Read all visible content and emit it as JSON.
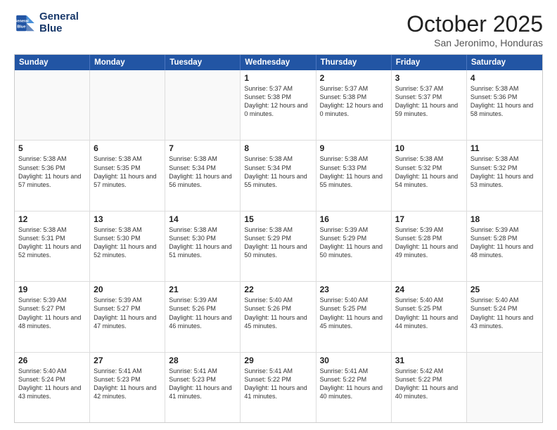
{
  "logo": {
    "line1": "General",
    "line2": "Blue"
  },
  "title": "October 2025",
  "location": "San Jeronimo, Honduras",
  "header_days": [
    "Sunday",
    "Monday",
    "Tuesday",
    "Wednesday",
    "Thursday",
    "Friday",
    "Saturday"
  ],
  "rows": [
    [
      {
        "day": "",
        "text": "",
        "empty": true
      },
      {
        "day": "",
        "text": "",
        "empty": true
      },
      {
        "day": "",
        "text": "",
        "empty": true
      },
      {
        "day": "1",
        "text": "Sunrise: 5:37 AM\nSunset: 5:38 PM\nDaylight: 12 hours\nand 0 minutes.",
        "empty": false
      },
      {
        "day": "2",
        "text": "Sunrise: 5:37 AM\nSunset: 5:38 PM\nDaylight: 12 hours\nand 0 minutes.",
        "empty": false
      },
      {
        "day": "3",
        "text": "Sunrise: 5:37 AM\nSunset: 5:37 PM\nDaylight: 11 hours\nand 59 minutes.",
        "empty": false
      },
      {
        "day": "4",
        "text": "Sunrise: 5:38 AM\nSunset: 5:36 PM\nDaylight: 11 hours\nand 58 minutes.",
        "empty": false
      }
    ],
    [
      {
        "day": "5",
        "text": "Sunrise: 5:38 AM\nSunset: 5:36 PM\nDaylight: 11 hours\nand 57 minutes.",
        "empty": false
      },
      {
        "day": "6",
        "text": "Sunrise: 5:38 AM\nSunset: 5:35 PM\nDaylight: 11 hours\nand 57 minutes.",
        "empty": false
      },
      {
        "day": "7",
        "text": "Sunrise: 5:38 AM\nSunset: 5:34 PM\nDaylight: 11 hours\nand 56 minutes.",
        "empty": false
      },
      {
        "day": "8",
        "text": "Sunrise: 5:38 AM\nSunset: 5:34 PM\nDaylight: 11 hours\nand 55 minutes.",
        "empty": false
      },
      {
        "day": "9",
        "text": "Sunrise: 5:38 AM\nSunset: 5:33 PM\nDaylight: 11 hours\nand 55 minutes.",
        "empty": false
      },
      {
        "day": "10",
        "text": "Sunrise: 5:38 AM\nSunset: 5:32 PM\nDaylight: 11 hours\nand 54 minutes.",
        "empty": false
      },
      {
        "day": "11",
        "text": "Sunrise: 5:38 AM\nSunset: 5:32 PM\nDaylight: 11 hours\nand 53 minutes.",
        "empty": false
      }
    ],
    [
      {
        "day": "12",
        "text": "Sunrise: 5:38 AM\nSunset: 5:31 PM\nDaylight: 11 hours\nand 52 minutes.",
        "empty": false
      },
      {
        "day": "13",
        "text": "Sunrise: 5:38 AM\nSunset: 5:30 PM\nDaylight: 11 hours\nand 52 minutes.",
        "empty": false
      },
      {
        "day": "14",
        "text": "Sunrise: 5:38 AM\nSunset: 5:30 PM\nDaylight: 11 hours\nand 51 minutes.",
        "empty": false
      },
      {
        "day": "15",
        "text": "Sunrise: 5:38 AM\nSunset: 5:29 PM\nDaylight: 11 hours\nand 50 minutes.",
        "empty": false
      },
      {
        "day": "16",
        "text": "Sunrise: 5:39 AM\nSunset: 5:29 PM\nDaylight: 11 hours\nand 50 minutes.",
        "empty": false
      },
      {
        "day": "17",
        "text": "Sunrise: 5:39 AM\nSunset: 5:28 PM\nDaylight: 11 hours\nand 49 minutes.",
        "empty": false
      },
      {
        "day": "18",
        "text": "Sunrise: 5:39 AM\nSunset: 5:28 PM\nDaylight: 11 hours\nand 48 minutes.",
        "empty": false
      }
    ],
    [
      {
        "day": "19",
        "text": "Sunrise: 5:39 AM\nSunset: 5:27 PM\nDaylight: 11 hours\nand 48 minutes.",
        "empty": false
      },
      {
        "day": "20",
        "text": "Sunrise: 5:39 AM\nSunset: 5:27 PM\nDaylight: 11 hours\nand 47 minutes.",
        "empty": false
      },
      {
        "day": "21",
        "text": "Sunrise: 5:39 AM\nSunset: 5:26 PM\nDaylight: 11 hours\nand 46 minutes.",
        "empty": false
      },
      {
        "day": "22",
        "text": "Sunrise: 5:40 AM\nSunset: 5:26 PM\nDaylight: 11 hours\nand 45 minutes.",
        "empty": false
      },
      {
        "day": "23",
        "text": "Sunrise: 5:40 AM\nSunset: 5:25 PM\nDaylight: 11 hours\nand 45 minutes.",
        "empty": false
      },
      {
        "day": "24",
        "text": "Sunrise: 5:40 AM\nSunset: 5:25 PM\nDaylight: 11 hours\nand 44 minutes.",
        "empty": false
      },
      {
        "day": "25",
        "text": "Sunrise: 5:40 AM\nSunset: 5:24 PM\nDaylight: 11 hours\nand 43 minutes.",
        "empty": false
      }
    ],
    [
      {
        "day": "26",
        "text": "Sunrise: 5:40 AM\nSunset: 5:24 PM\nDaylight: 11 hours\nand 43 minutes.",
        "empty": false
      },
      {
        "day": "27",
        "text": "Sunrise: 5:41 AM\nSunset: 5:23 PM\nDaylight: 11 hours\nand 42 minutes.",
        "empty": false
      },
      {
        "day": "28",
        "text": "Sunrise: 5:41 AM\nSunset: 5:23 PM\nDaylight: 11 hours\nand 41 minutes.",
        "empty": false
      },
      {
        "day": "29",
        "text": "Sunrise: 5:41 AM\nSunset: 5:22 PM\nDaylight: 11 hours\nand 41 minutes.",
        "empty": false
      },
      {
        "day": "30",
        "text": "Sunrise: 5:41 AM\nSunset: 5:22 PM\nDaylight: 11 hours\nand 40 minutes.",
        "empty": false
      },
      {
        "day": "31",
        "text": "Sunrise: 5:42 AM\nSunset: 5:22 PM\nDaylight: 11 hours\nand 40 minutes.",
        "empty": false
      },
      {
        "day": "",
        "text": "",
        "empty": true
      }
    ]
  ]
}
